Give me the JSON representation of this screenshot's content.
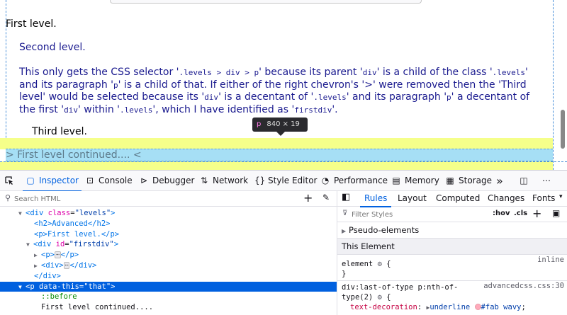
{
  "page": {
    "first_level": "First level.",
    "second_level": "Second level.",
    "para": {
      "l1a": "This only gets the CSS selector '",
      "l1b": ".levels > div > p",
      "l1c": "' because its parent '",
      "l1d": "div",
      "l1e": "' is a child of the class '",
      "l1f": ".levels",
      "l1g": "'",
      "l2a": "and its paragraph '",
      "l2b": "p",
      "l2c": "' is a child of that. If either of the right chevron's '",
      "l2d": ">",
      "l2e": "' were removed then the 'Third",
      "l3a": "level' would be selected because its '",
      "l3b": "div",
      "l3c": "' is a decentant of '",
      "l3d": ".levels",
      "l3e": "' and its paragraph '",
      "l3f": "p",
      "l3g": "' a decentant of",
      "l4a": "the first '",
      "l4b": "div",
      "l4c": "' within '",
      "l4d": ".levels",
      "l4e": "', which I have identified as '",
      "l4f": "firstdiv",
      "l4g": "'."
    },
    "third_level": "Third level.",
    "continued": "> First level continued.... <",
    "tooltip_tag": "p",
    "tooltip_size": "840 × 19"
  },
  "toolbar": {
    "inspector": "Inspector",
    "console": "Console",
    "debugger": "Debugger",
    "network": "Network",
    "style_editor": "Style Editor",
    "performance": "Performance",
    "memory": "Memory",
    "storage": "Storage",
    "more": "»"
  },
  "markup": {
    "search_placeholder": "Search HTML",
    "add": "+",
    "n1_tag": "div",
    "n1_attr": "class",
    "n1_val": "\"levels\"",
    "n2": "<h2>Advanced</h2>",
    "n3": "<p>First level.</p>",
    "n4_tag": "div",
    "n4_attr": "id",
    "n4_val": "\"firstdiv\"",
    "n5_open": "<p>",
    "n5_close": "</p>",
    "n6_open": "<div>",
    "n6_close": "</div>",
    "n7": "</div>",
    "n8_tag": "p",
    "n8_attr": "data-this",
    "n8_val": "\"that\"",
    "n9": "::before",
    "n10": "First level continued....",
    "dots": "⋯"
  },
  "rules_panel": {
    "tabs": [
      "Rules",
      "Layout",
      "Computed",
      "Changes",
      "Fonts"
    ],
    "filter_placeholder": "Filter Styles",
    "hov": ":hov",
    "cls": ".cls",
    "pseudo_elements": "Pseudo-elements",
    "this_element": "This Element",
    "element_sel": "element",
    "open_brace": "{",
    "close_brace": "}",
    "inline": "inline",
    "selector2a": "div:last-of-type p:nth-of-",
    "selector2b": "type(2)",
    "source2": "advancedcss.css:30",
    "prop_name": "text-decoration",
    "prop_underline": "underline",
    "prop_color": "#fab",
    "prop_wavy": "wavy",
    "colon": ":",
    "semicolon": ";"
  },
  "colors": {
    "accent": "#0061e0",
    "highlight_yellow": "#f5ff8a",
    "highlight_cyan": "#a6dff5",
    "text_blue": "#1b1b8f",
    "swatch": "#fab"
  },
  "icons": [
    "picker-icon",
    "inspector-icon",
    "console-icon",
    "debugger-icon",
    "network-icon",
    "style-editor-icon",
    "performance-icon",
    "memory-icon",
    "storage-icon",
    "dock-icon",
    "meatball-icon",
    "search-icon",
    "eyedropper-icon",
    "filter-icon",
    "sidebar-toggle-icon",
    "light-dark-icon",
    "gear-icon"
  ]
}
